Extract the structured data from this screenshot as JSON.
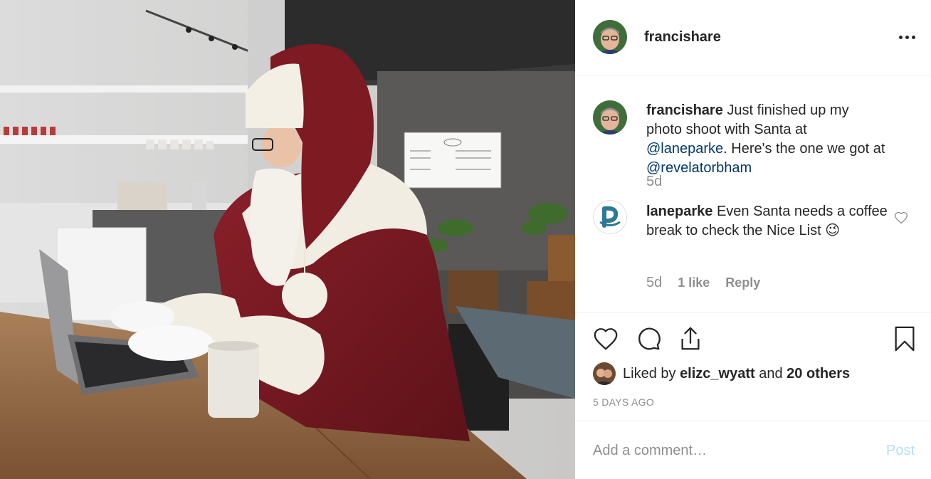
{
  "post": {
    "author": "francishare",
    "photo_alt": "Santa Claus typing on a laptop at a cafe table",
    "caption": {
      "user": "francishare",
      "text_1": " Just finished up my photo shoot with Santa at ",
      "mention_1": "@laneparke",
      "text_2": ". Here's the one we got at ",
      "mention_2": "@revelatorbham",
      "time": "5d"
    },
    "comment": {
      "user": "laneparke",
      "text": " Even Santa needs a coffee break to check the Nice List ",
      "emoji": "😉",
      "time": "5d",
      "likes": "1 like",
      "reply": "Reply"
    },
    "liked_by": {
      "prefix": "Liked by ",
      "user": "elizc_wyatt",
      "and": " and ",
      "others": "20 others"
    },
    "timestamp": "5 DAYS AGO",
    "add_comment": {
      "placeholder": "Add a comment…",
      "post_label": "Post"
    }
  },
  "colors": {
    "mention": "#00376b",
    "muted": "#8e8e8e",
    "post_disabled": "#b2dffc",
    "santa_red": "#7d1a22"
  },
  "icons": [
    "more-icon",
    "heart-icon",
    "comment-icon",
    "share-icon",
    "bookmark-icon",
    "heart-small-icon"
  ]
}
